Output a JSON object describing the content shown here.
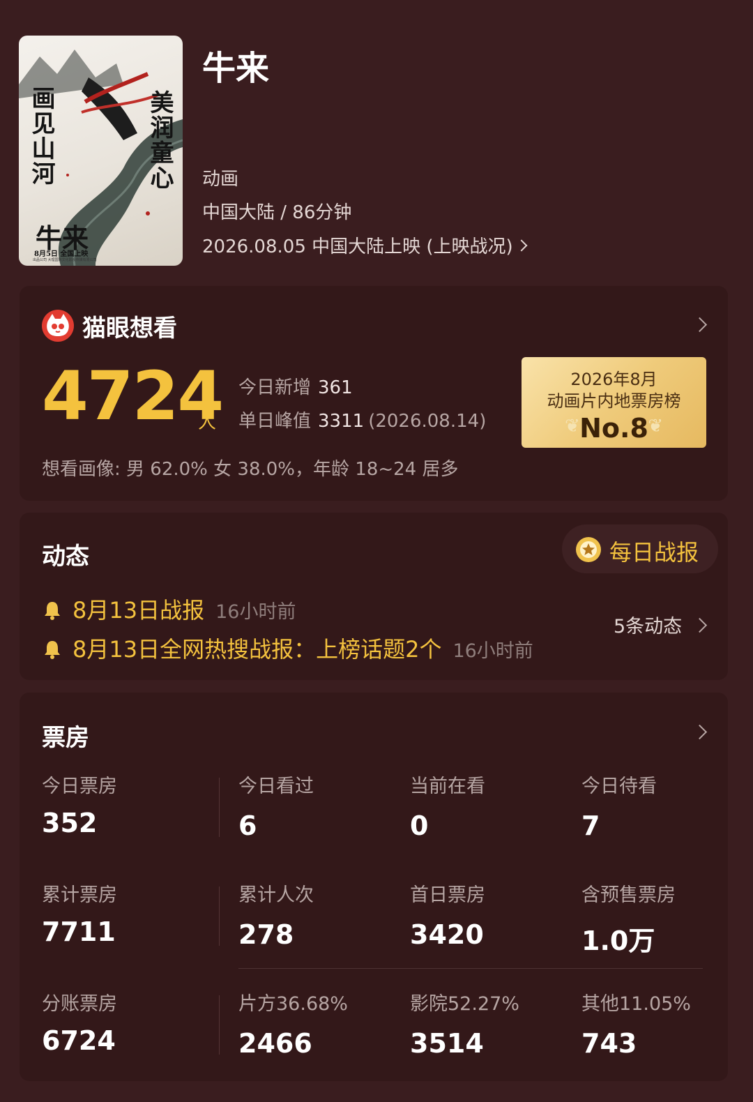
{
  "colors": {
    "background": "#3a1d1f",
    "card": "#331819",
    "accent_gold": "#f4c23e",
    "muted_text": "#b7a6a4",
    "maoyan_red": "#e23c31"
  },
  "header": {
    "poster": {
      "vertical_text_left": "画见山河",
      "vertical_text_right": "美润童心",
      "name": "牛来",
      "date": "8月5日 全国上映",
      "fine_print": "出品公司  大理国际文化影视传媒有限公司"
    },
    "title": "牛来",
    "genre": "动画",
    "region_duration": "中国大陆 / 86分钟",
    "release": "2026.08.05 中国大陆上映 (上映战况)",
    "release_chevron_icon": "chevron-right-icon"
  },
  "want": {
    "logo_icon": "maoyan-cat-icon",
    "heading": "猫眼想看",
    "count": "4724",
    "unit": "人",
    "today_label": "今日新增",
    "today_value": "361",
    "peak_label": "单日峰值",
    "peak_value": "3311",
    "peak_date": "(2026.08.14)",
    "badge_line1": "2026年8月",
    "badge_line2": "动画片内地票房榜",
    "badge_rank": "No.8",
    "profile": "想看画像: 男 62.0%  女 38.0%，年龄 18~24 居多"
  },
  "news": {
    "heading": "动态",
    "daily_report_icon": "medal-star-icon",
    "daily_report_label": "每日战报",
    "items": [
      {
        "icon": "bell-icon",
        "text": "8月13日战报",
        "time": "16小时前"
      },
      {
        "icon": "bell-icon",
        "text": "8月13日全网热搜战报：上榜话题2个",
        "time": "16小时前"
      }
    ],
    "more": "5条动态"
  },
  "boxoffice": {
    "heading": "票房",
    "rows": [
      [
        {
          "label": "今日票房",
          "value": "352"
        },
        {
          "label": "今日看过",
          "value": "6"
        },
        {
          "label": "当前在看",
          "value": "0"
        },
        {
          "label": "今日待看",
          "value": "7"
        }
      ],
      [
        {
          "label": "累计票房",
          "value": "7711"
        },
        {
          "label": "累计人次",
          "value": "278"
        },
        {
          "label": "首日票房",
          "value": "3420"
        },
        {
          "label": "含预售票房",
          "value": "1.0万"
        }
      ],
      [
        {
          "label": "分账票房",
          "value": "6724"
        },
        {
          "label": "片方36.68%",
          "value": "2466"
        },
        {
          "label": "影院52.27%",
          "value": "3514"
        },
        {
          "label": "其他11.05%",
          "value": "743"
        }
      ]
    ]
  }
}
